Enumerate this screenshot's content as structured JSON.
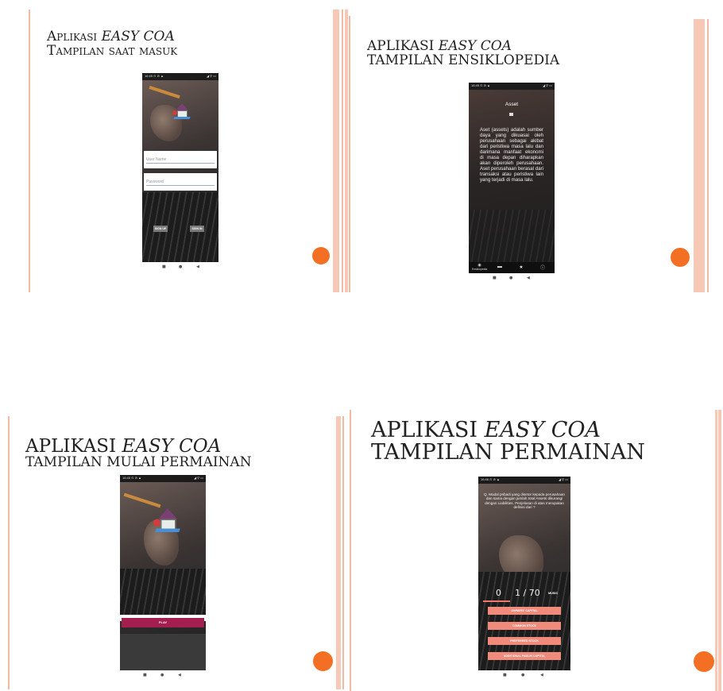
{
  "slides": [
    {
      "title_line1_prefix": "Aplikasi ",
      "title_line1_italic": "EASY COA",
      "title_line2": "Tampilan saat masuk",
      "phone": {
        "status_left": "16:45 ⊙ ⊘ ▲",
        "status_right": "◢ ⚲ ▭",
        "username_placeholder": "User Name",
        "password_placeholder": "Password",
        "signup_label": "SIGN UP",
        "signin_label": "SIGN IN"
      }
    },
    {
      "title_line1_prefix": "APLIKASI ",
      "title_line1_italic": "EASY COA",
      "title_line2": "TAMPILAN ENSIKLOPEDIA",
      "phone": {
        "status_left": "16:45 ⊙ ⊘ ▲",
        "status_right": "◢ ⚲ ▭",
        "heading": "Asset",
        "article": "Aset (assets) adalah sumber daya yang dikuasai oleh perusahaan sebagai akibat dari peristiwa masa lalu dan darimana manfaat ekonomi di masa depan diharapkan akan diperoleh perusahaan. Aset perusahaan berasal dari transaksi atau peristiwa lain yang terjadi di masa lalu.",
        "tab_ensiklopedia": "Ensiklopedia"
      }
    },
    {
      "title_line1_prefix": "APLIKASI ",
      "title_line1_italic": "EASY COA",
      "title_line2": "TAMPILAN MULAI PERMAINAN",
      "phone": {
        "status_left": "16:45 ⊙ ⊘ ▲",
        "status_right": "◢ ⚲ ▭",
        "play_label": "PLAY"
      }
    },
    {
      "title_line1_prefix": "APLIKASI ",
      "title_line1_italic": "EASY COA",
      "title_line2": "TAMPILAN PERMAINAN",
      "phone": {
        "status_left": "16:46 ⊙ ⊘ ▲",
        "status_right": "◢ ⚲ ▭",
        "question": "Q. Modal pribadi yang disetor kepada perusahaan dan sama dengan jumlah total Assets dikurangi dengan Liabilities. Penjelasan di atas merupakan definisi dari ?",
        "score": "0",
        "progress": "1 / 70",
        "music_label": "MUSIC",
        "answers": [
          "OWNERS' CAPITAL",
          "COMMON STOCK",
          "PREFERRED STOCK",
          "ADDITIONAL PAID-IN CAPITAL"
        ]
      }
    }
  ],
  "colors": {
    "accent_orange": "#f26f24",
    "line_peach": "#f4b9a3",
    "play_magenta": "#a51f4e",
    "answer_salmon": "#f08a7a"
  },
  "icons": [
    "back-icon",
    "home-icon",
    "recent-apps-icon",
    "eye-icon",
    "chat-icon",
    "star-icon",
    "info-icon"
  ]
}
